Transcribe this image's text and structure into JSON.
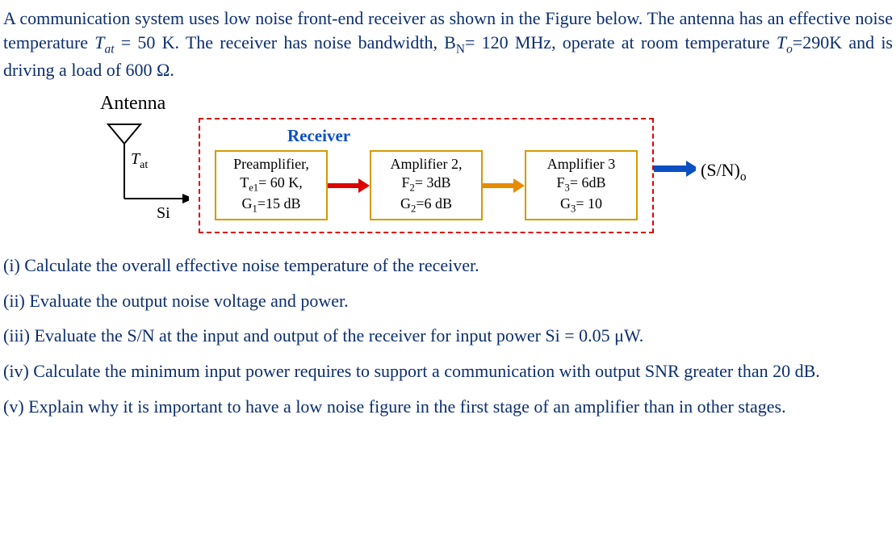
{
  "intro_html": "A communication system uses low noise front-end receiver as shown in the Figure below. The antenna has an effective noise temperature <span class=\"italic\">T<sub>at</sub></span> = 50 K. The receiver has noise bandwidth, B<sub>N</sub>= 120 MHz, operate at room temperature <span class=\"italic\">T<sub>o</sub></span>=290K and is driving a load of 600 Ω.",
  "diagram": {
    "antenna_label": "Antenna",
    "tat_html": "<span class=\"italic\">T<sub>at</sub></span>",
    "si_label": "Si",
    "receiver_title": "Receiver",
    "stage1_html": "Preamplifier,<br>T<sub>e1</sub>= 60 K,<br>G<sub>1</sub>=15 dB",
    "stage2_html": "Amplifier 2,<br>F<sub>2</sub>= 3dB<br>G<sub>2</sub>=6 dB",
    "stage3_html": "Amplifier 3<br>F<sub>3</sub>= 6dB<br>G<sub>3</sub>= 10",
    "snr_out_html": "(S/N)<sub>o</sub>"
  },
  "questions": {
    "q1": "(i) Calculate the overall effective noise temperature of the receiver.",
    "q2": "(ii) Evaluate the output noise voltage and power.",
    "q3_main": "(iii)  Evaluate  the  S/N  at  the  input  and  output  of  the  receiver  for  input  power  Si  =  0.05 μW.",
    "q4_main": "(iv) Calculate the minimum input power requires to support a communication with output SNR greater than 20 dB.",
    "q5_main": "(v) Explain why it is important to have a low noise figure in the first stage of an amplifier than in other stages."
  },
  "chart_data": {
    "type": "diagram",
    "antenna": {
      "effective_noise_temperature_K": 50,
      "symbol": "Tat",
      "input_signal_symbol": "Si"
    },
    "receiver": {
      "noise_bandwidth_MHz": 120,
      "room_temperature_K": 290,
      "load_ohm": 600,
      "stages": [
        {
          "name": "Preamplifier",
          "Te_K": 60,
          "G_dB": 15
        },
        {
          "name": "Amplifier 2",
          "F_dB": 3,
          "G_dB": 6
        },
        {
          "name": "Amplifier 3",
          "F_dB": 6,
          "G": 10
        }
      ],
      "output_symbol": "(S/N)o"
    },
    "questions": [
      "overall effective noise temperature of the receiver",
      "output noise voltage and power",
      "S/N at input and output for Si = 0.05 μW",
      "minimum input power for output SNR > 20 dB",
      "importance of low noise figure in first amplifier stage"
    ]
  }
}
